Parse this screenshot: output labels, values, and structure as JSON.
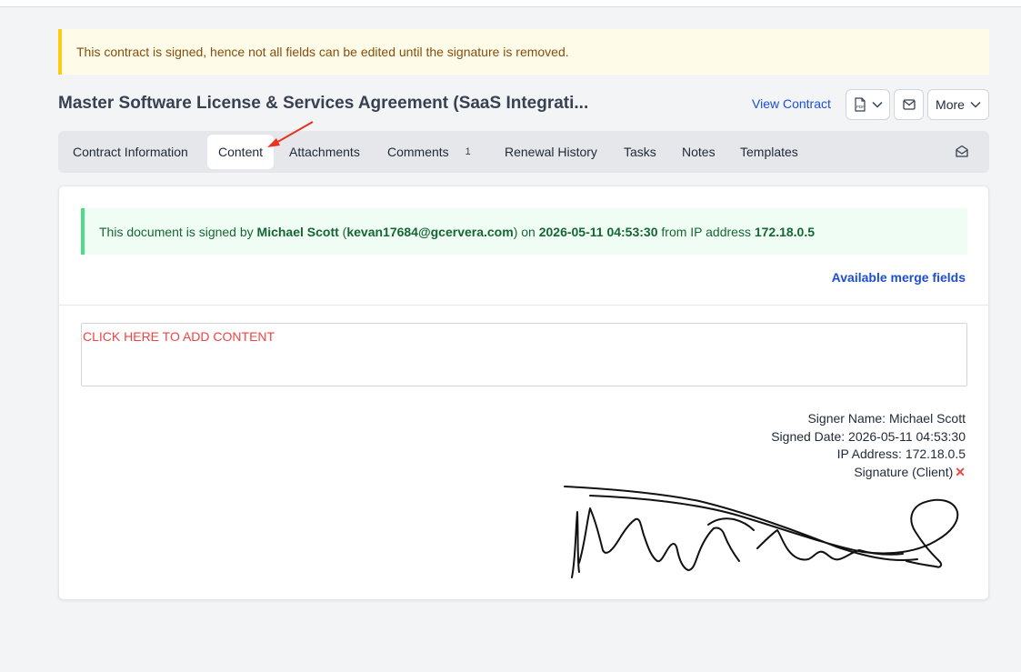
{
  "alert": {
    "text": "This contract is signed, hence not all fields can be edited until the signature is removed."
  },
  "header": {
    "title": "Master Software License & Services Agreement (SaaS Integrati...",
    "view_contract": "View Contract",
    "more_label": "More"
  },
  "tabs": [
    {
      "label": "Contract Information"
    },
    {
      "label": "Content",
      "active": true
    },
    {
      "label": "Attachments"
    },
    {
      "label": "Comments",
      "badge": "1"
    },
    {
      "label": "Renewal History"
    },
    {
      "label": "Tasks"
    },
    {
      "label": "Notes"
    },
    {
      "label": "Templates"
    }
  ],
  "signed_note": {
    "prefix": "This document is signed by",
    "signer": "Michael Scott",
    "email": "kevan17684@gcervera.com",
    "on": "on",
    "date": "2026-05-11 04:53:30",
    "from": "from IP address",
    "ip": "172.18.0.5"
  },
  "merge_fields_link": "Available merge fields",
  "content_placeholder": "CLICK HERE TO ADD CONTENT",
  "signature_block": {
    "signer_name": "Signer Name: Michael Scott",
    "signed_date": "Signed Date: 2026-05-11 04:53:30",
    "ip_address": "IP Address: 172.18.0.5",
    "signature_label": "Signature (Client)",
    "remove_glyph": "✕"
  },
  "icons": {
    "pdf": "pdf-file-icon",
    "chevron": "chevron-down-icon",
    "mail": "mail-icon",
    "open_mail": "mail-open-icon"
  },
  "colors": {
    "warning_bg": "#fefce8",
    "warning_border": "#facc15",
    "success_bg": "#f0fdf4",
    "success_border": "#4ade80",
    "link": "#1d4ed8",
    "placeholder_red": "#ef4444",
    "annotation_arrow": "#e8331f"
  }
}
